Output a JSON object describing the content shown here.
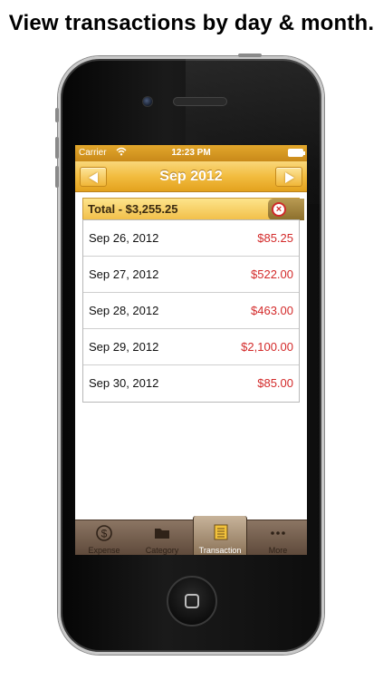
{
  "headline": "View transactions by day & month.",
  "status_bar": {
    "carrier": "Carrier",
    "time": "12:23 PM"
  },
  "nav": {
    "title": "Sep 2012"
  },
  "total": {
    "label": "Total - $3,255.25"
  },
  "transactions": [
    {
      "date": "Sep 26, 2012",
      "amount": "$85.25"
    },
    {
      "date": "Sep 27, 2012",
      "amount": "$522.00"
    },
    {
      "date": "Sep 28, 2012",
      "amount": "$463.00"
    },
    {
      "date": "Sep 29, 2012",
      "amount": "$2,100.00"
    },
    {
      "date": "Sep 30, 2012",
      "amount": "$85.00"
    }
  ],
  "tabs": [
    {
      "label": "Expense",
      "icon": "dollar-icon"
    },
    {
      "label": "Category",
      "icon": "folder-icon"
    },
    {
      "label": "Transaction",
      "icon": "ledger-icon",
      "active": true
    },
    {
      "label": "More",
      "icon": "more-dots-icon"
    }
  ],
  "colors": {
    "nav_gold": "#f2bc3f",
    "amount_red": "#d32a2a",
    "tab_bar_brown": "#5f4a3b"
  }
}
